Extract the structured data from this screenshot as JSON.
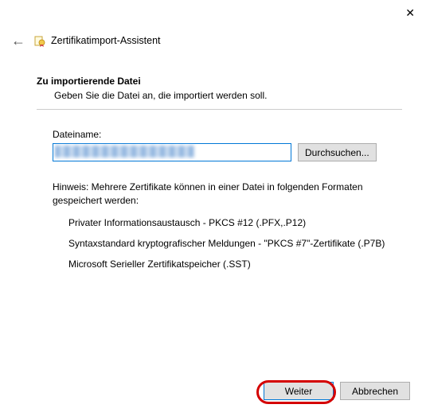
{
  "window": {
    "close_glyph": "✕",
    "back_glyph": "←",
    "title": "Zertifikatimport-Assistent"
  },
  "section": {
    "title": "Zu importierende Datei",
    "description": "Geben Sie die Datei an, die importiert werden soll."
  },
  "file": {
    "label": "Dateiname:",
    "value": "",
    "browse_label": "Durchsuchen..."
  },
  "hint": "Hinweis: Mehrere Zertifikate können in einer Datei in folgenden Formaten gespeichert werden:",
  "formats": [
    "Privater Informationsaustausch - PKCS #12 (.PFX,.P12)",
    "Syntaxstandard kryptografischer Meldungen - \"PKCS #7\"-Zertifikate (.P7B)",
    "Microsoft Serieller Zertifikatspeicher (.SST)"
  ],
  "footer": {
    "next_label": "Weiter",
    "cancel_label": "Abbrechen"
  }
}
